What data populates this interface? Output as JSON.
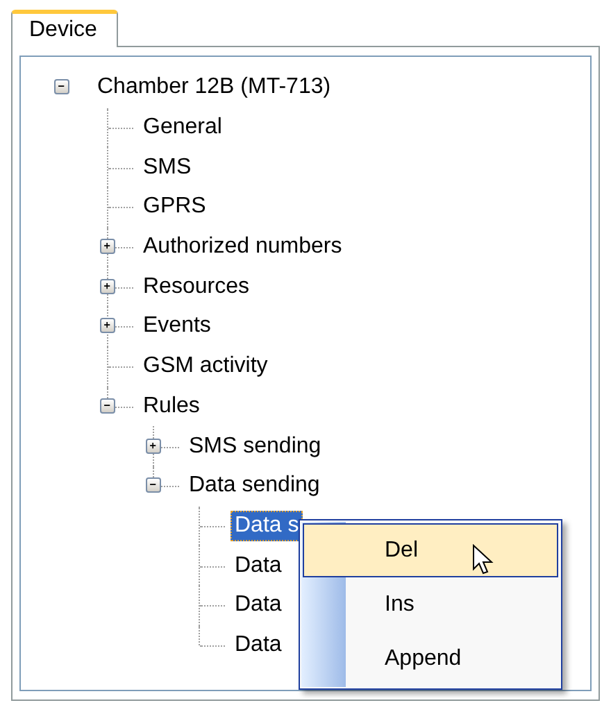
{
  "tabs": [
    {
      "label": "Device",
      "selected": true
    }
  ],
  "tree": [
    {
      "label": "Chamber 12B (MT-713)",
      "expanded": true,
      "selected": false,
      "children": [
        {
          "label": "General",
          "selected": false
        },
        {
          "label": "SMS",
          "selected": false
        },
        {
          "label": "GPRS",
          "selected": false
        },
        {
          "label": "Authorized numbers",
          "expanded": false,
          "selected": false
        },
        {
          "label": "Resources",
          "expanded": false,
          "selected": false
        },
        {
          "label": "Events",
          "expanded": false,
          "selected": false
        },
        {
          "label": "GSM activity",
          "selected": false
        },
        {
          "label": "Rules",
          "expanded": true,
          "selected": false,
          "children": [
            {
              "label": "SMS sending",
              "expanded": false,
              "selected": false
            },
            {
              "label": "Data sending",
              "expanded": true,
              "selected": false,
              "children": [
                {
                  "label": "Data s",
                  "selected": true
                },
                {
                  "label": "Data",
                  "selected": false
                },
                {
                  "label": "Data",
                  "selected": false
                },
                {
                  "label": "Data",
                  "selected": false
                }
              ]
            }
          ]
        }
      ]
    }
  ],
  "context_menu": {
    "items": [
      {
        "label": "Del",
        "selected": true
      },
      {
        "label": "Ins",
        "selected": false
      },
      {
        "label": "Append",
        "selected": false
      }
    ]
  }
}
